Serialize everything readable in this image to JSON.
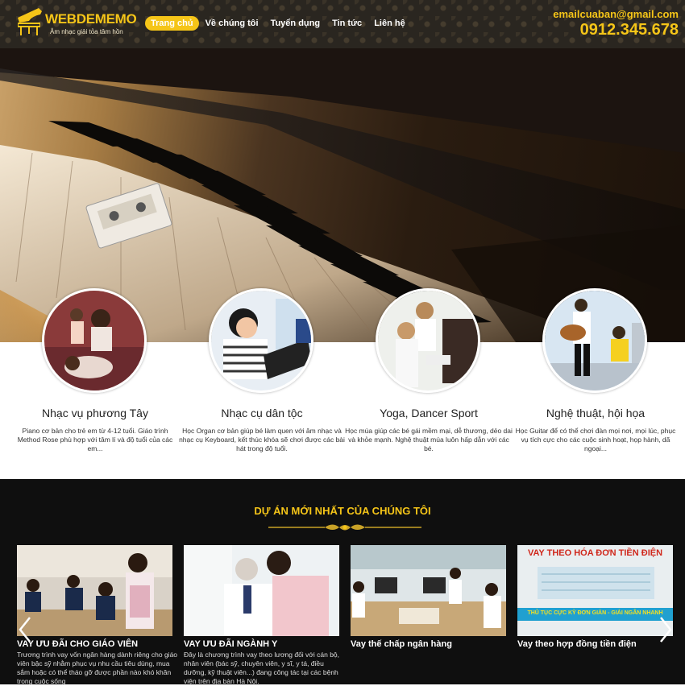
{
  "header": {
    "logo_title": "WEBDEMEMO",
    "logo_subtitle": "Âm nhạc giải tỏa tâm hồn",
    "nav": [
      "Trang chủ",
      "Về chúng tôi",
      "Tuyển dụng",
      "Tin tức",
      "Liên hệ"
    ],
    "active_nav": "Trang chủ",
    "email": "emailcuaban@gmail.com",
    "phone": "0912.345.678"
  },
  "courses": [
    {
      "title": "Nhạc vụ phương Tây",
      "desc": "Piano cơ bản cho trẻ em từ 4-12 tuổi. Giáo trình Method Rose phù hợp với tâm lí và độ tuổi của các em..."
    },
    {
      "title": "Nhạc cụ dân tộc",
      "desc": "Học Organ cơ bản giúp bé làm quen với âm nhạc và nhạc cụ Keyboard, kết thúc khóa sẽ chơi được các bài hát trong độ tuổi."
    },
    {
      "title": "Yoga, Dancer Sport",
      "desc": "Học múa giúp các bé gái mềm mại, dễ thương, dẻo dai và khỏe mạnh. Nghệ thuật múa luôn hấp dẫn với các bé."
    },
    {
      "title": "Nghệ thuật, hội họa",
      "desc": "Học Guitar để có thể chơi đàn mọi nơi, mọi lúc, phục vụ tích cực cho các cuộc sinh hoạt, họp hành, dã ngoại..."
    }
  ],
  "projects": {
    "heading": "DỰ ÁN MỚI NHẤT CỦA CHÚNG TÔI",
    "cards": [
      {
        "title": "VAY ƯU ĐÃI CHO GIÁO VIÊN",
        "desc": " Trương trình vay vốn ngân hàng dành riêng cho giáo viên bậc sỹ nhằm phục vụ nhu cầu tiêu dùng, mua sắm hoặc có thể tháo gỡ được phần nào khó khăn trong cuộc sống"
      },
      {
        "title": "VAY ƯU ĐÃI NGÀNH Y",
        "desc": "Đây là chương trình vay theo lương đối với cán bộ, nhân viên (bác sỹ, chuyên viên, y sĩ, y tá, điều dưỡng, kỹ thuật viên...) đang công tác tại các bệnh viện trên địa bàn Hà Nội."
      },
      {
        "title": "Vay thế chấp ngân hàng",
        "desc": ""
      },
      {
        "title": "Vay theo hợp đồng tiền điện",
        "desc": "",
        "banner_title": "VAY THEO HÓA ĐƠN TIỀN ĐIỆN",
        "banner_sub": "THỦ TỤC CỰC KỲ ĐƠN GIẢN - GIẢI NGÂN NHANH"
      }
    ]
  },
  "colors": {
    "accent": "#f5c518",
    "dark": "#0f0f0f",
    "header": "#2a2620"
  },
  "icons": {
    "logo": "grand-piano-icon",
    "prev": "chevron-left-icon",
    "next": "chevron-right-icon"
  }
}
